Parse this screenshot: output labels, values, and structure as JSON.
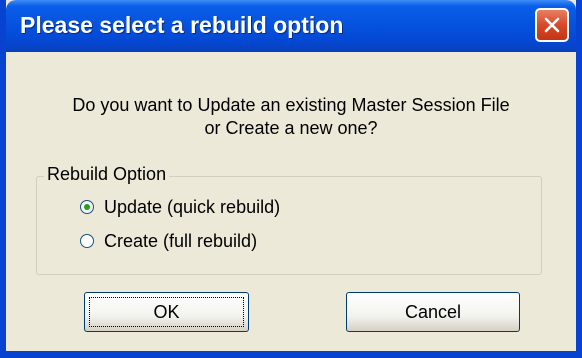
{
  "dialog": {
    "title": "Please select a rebuild option",
    "message_line1": "Do you want to Update an existing Master Session File",
    "message_line2": "or Create a new one?"
  },
  "group": {
    "legend": "Rebuild Option",
    "options": [
      {
        "label": "Update (quick rebuild)",
        "checked": true
      },
      {
        "label": "Create (full rebuild)",
        "checked": false
      }
    ]
  },
  "buttons": {
    "ok": "OK",
    "cancel": "Cancel"
  },
  "icons": {
    "close": "close-icon"
  },
  "colors": {
    "titlebar": "#0553e0",
    "close_button": "#d8482a",
    "dialog_background": "#ece9d8"
  }
}
